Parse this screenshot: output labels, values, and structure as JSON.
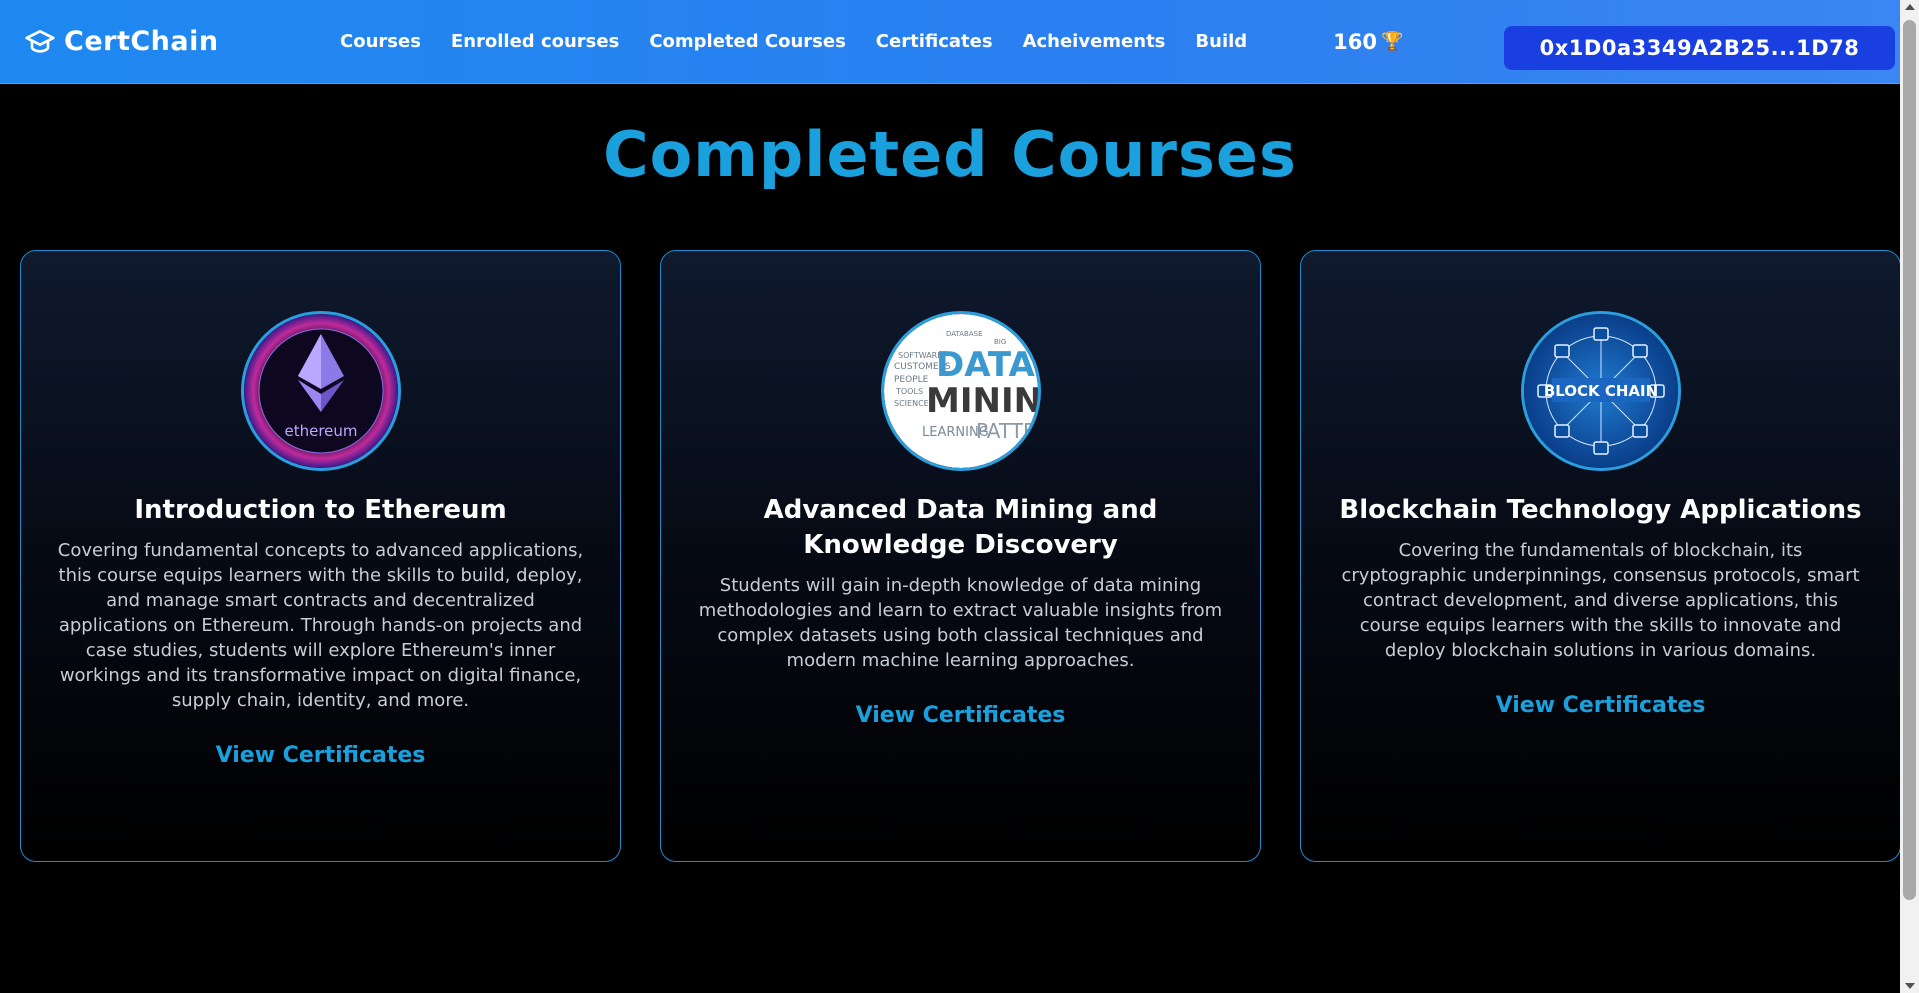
{
  "nav": {
    "brand": "CertChain",
    "links": [
      "Courses",
      "Enrolled courses",
      "Completed Courses",
      "Certificates",
      "Acheivements",
      "Build"
    ],
    "points": "160",
    "trophy": "🏆",
    "wallet": "0x1D0a3349A2B25...1D78"
  },
  "page": {
    "title": "Completed Courses"
  },
  "courses": [
    {
      "title": "Introduction to Ethereum",
      "description": "Covering fundamental concepts to advanced applications, this course equips learners with the skills to build, deploy, and manage smart contracts and decentralized applications on Ethereum. Through hands-on projects and case studies, students will explore Ethereum's inner workings and its transformative impact on digital finance, supply chain, identity, and more.",
      "link": "View Certificates",
      "image_text": "ethereum"
    },
    {
      "title": "Advanced Data Mining and Knowledge Discovery",
      "description": "Students will gain in-depth knowledge of data mining methodologies and learn to extract valuable insights from complex datasets using both classical techniques and modern machine learning approaches.",
      "link": "View Certificates",
      "image_text": "DATA MINING"
    },
    {
      "title": "Blockchain Technology Applications",
      "description": "Covering the fundamentals of blockchain, its cryptographic underpinnings, consensus protocols, smart contract development, and diverse applications, this course equips learners with the skills to innovate and deploy blockchain solutions in various domains.",
      "link": "View Certificates",
      "image_text": "BLOCK CHAIN"
    }
  ],
  "colors": {
    "accent": "#1aa0dc",
    "navbar": "#2b7ff0",
    "wallet": "#1a3fe0",
    "card_border": "#1b8ad0"
  }
}
